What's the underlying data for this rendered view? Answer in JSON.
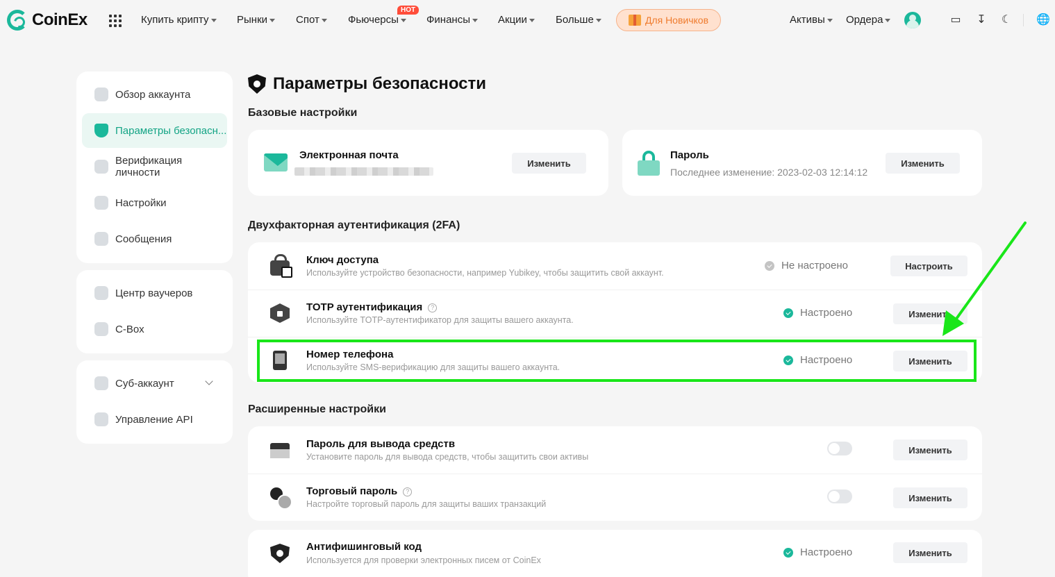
{
  "brand": {
    "name": "CoinEx"
  },
  "nav": {
    "items": [
      "Купить крипту",
      "Рынки",
      "Спот",
      "Фьючерсы",
      "Финансы",
      "Акции",
      "Больше"
    ],
    "hot_badge": "HOT",
    "newbie": "Для Новичков",
    "assets": "Активы",
    "orders": "Ордера"
  },
  "sidebar": {
    "group1": [
      "Обзор аккаунта",
      "Параметры безопасн...",
      "Верификация личности",
      "Настройки",
      "Сообщения"
    ],
    "group2": [
      "Центр ваучеров",
      "C-Box"
    ],
    "group3": [
      "Суб-аккаунт",
      "Управление API"
    ]
  },
  "page": {
    "title": "Параметры безопасности"
  },
  "basic": {
    "title": "Базовые настройки",
    "email": {
      "title": "Электронная почта",
      "button": "Изменить"
    },
    "password": {
      "title": "Пароль",
      "subtitle": "Последнее изменение: 2023-02-03 12:14:12",
      "button": "Изменить"
    }
  },
  "twofa": {
    "title": "Двухфакторная аутентификация (2FA)",
    "rows": [
      {
        "title": "Ключ доступа",
        "desc": "Используйте устройство безопасности, например Yubikey, чтобы защитить свой аккаунт.",
        "status": "Не настроено",
        "button": "Настроить"
      },
      {
        "title": "TOTP аутентификация",
        "desc": "Используйте TOTP-аутентификатор для защиты вашего аккаунта.",
        "status": "Настроено",
        "button": "Изменить"
      },
      {
        "title": "Номер телефона",
        "desc": "Используйте SMS-верификацию для защиты вашего аккаунта.",
        "status": "Настроено",
        "button": "Изменить"
      }
    ]
  },
  "advanced": {
    "title": "Расширенные настройки",
    "rows": [
      {
        "title": "Пароль для вывода средств",
        "desc": "Установите пароль для вывода средств, чтобы защитить свои активы",
        "button": "Изменить",
        "enabled": false
      },
      {
        "title": "Торговый пароль",
        "desc": "Настройте торговый пароль для защиты ваших транзакций",
        "button": "Изменить",
        "enabled": false
      }
    ],
    "antiphishing": {
      "title": "Антифишинговый код",
      "desc": "Используется для проверки электронных писем от CoinEx",
      "status": "Настроено",
      "button": "Изменить"
    }
  },
  "colors": {
    "accent": "#1bb89b",
    "highlight": "#19e619",
    "newbie_bg": "#ffe1cf"
  }
}
